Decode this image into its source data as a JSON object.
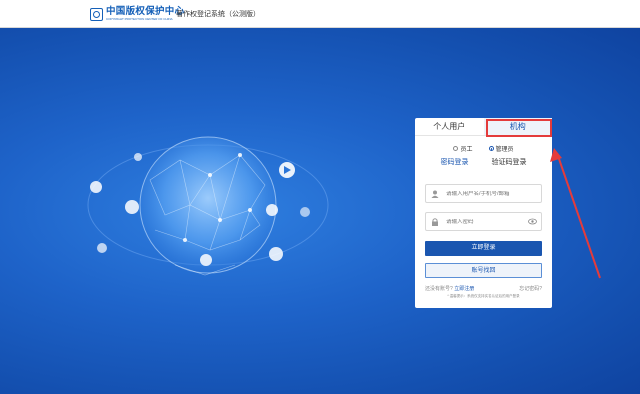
{
  "header": {
    "logo_cn": "中国版权保护中心",
    "logo_en": "COPYRIGHT PROTECTION CENTER OF CHINA",
    "system_title": "著作权登记系统（公测版）"
  },
  "login": {
    "tabs": [
      "个人用户",
      "机构"
    ],
    "roles": [
      "员工",
      "管理员"
    ],
    "selected_role": "管理员",
    "modes": [
      "密码登录",
      "验证码登录"
    ],
    "username_placeholder": "请输入用户名/手机号/邮箱",
    "password_placeholder": "请输入密码",
    "login_button": "立即登录",
    "account_binding_button": "账号找回",
    "no_account_text": "还没有账号?",
    "register_link": "立即注册",
    "forgot_link": "忘记密码?",
    "note": "* 温馨提示：系统仅支持实名认证后的用户登录"
  },
  "colors": {
    "brand": "#1560b8",
    "primary_button": "#1a56b0",
    "highlight": "#e43b3b"
  }
}
